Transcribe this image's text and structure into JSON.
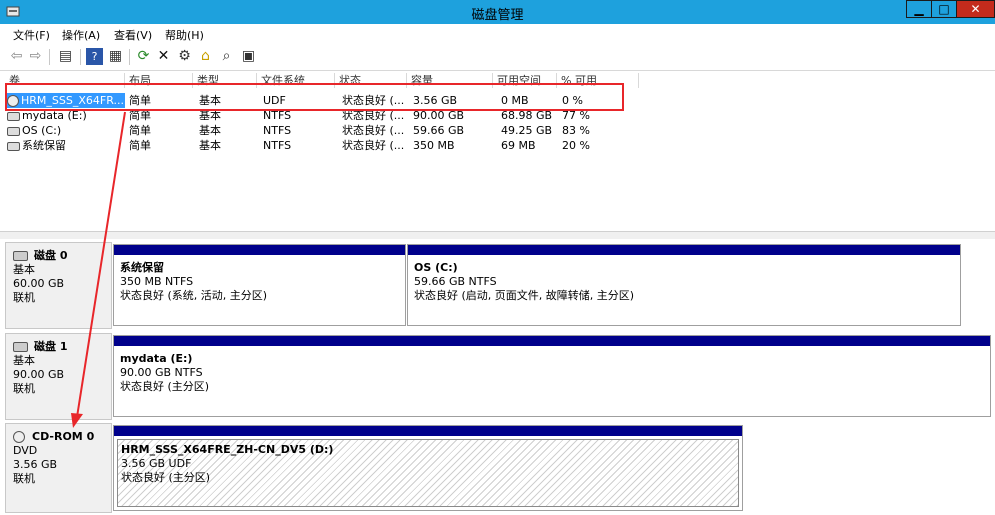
{
  "window": {
    "title": "磁盘管理",
    "min": "▁",
    "max": "□",
    "close": "✕"
  },
  "menu": [
    "文件(F)",
    "操作(A)",
    "查看(V)",
    "帮助(H)"
  ],
  "toolbar": {
    "icons": [
      "back-arrow-icon",
      "forward-arrow-icon",
      "show-hide-tree-icon",
      "help-icon",
      "properties-icon",
      "refresh-icon",
      "delete-icon",
      "settings-icon",
      "open-folder-icon",
      "search-icon",
      "disk-properties-icon"
    ]
  },
  "columns": [
    "卷",
    "布局",
    "类型",
    "文件系统",
    "状态",
    "容量",
    "可用空间",
    "% 可用"
  ],
  "volumes": [
    {
      "name": "HRM_SSS_X64FR...",
      "layout": "简单",
      "type": "基本",
      "fs": "UDF",
      "status": "状态良好 (...",
      "capacity": "3.56 GB",
      "free": "0 MB",
      "pct": "0 %",
      "icon": "cdrom-icon",
      "selected": true
    },
    {
      "name": "mydata (E:)",
      "layout": "简单",
      "type": "基本",
      "fs": "NTFS",
      "status": "状态良好 (...",
      "capacity": "90.00 GB",
      "free": "68.98 GB",
      "pct": "77 %",
      "icon": "drive-icon",
      "selected": false
    },
    {
      "name": "OS (C:)",
      "layout": "简单",
      "type": "基本",
      "fs": "NTFS",
      "status": "状态良好 (...",
      "capacity": "59.66 GB",
      "free": "49.25 GB",
      "pct": "83 %",
      "icon": "drive-icon",
      "selected": false
    },
    {
      "name": "系统保留",
      "layout": "简单",
      "type": "基本",
      "fs": "NTFS",
      "status": "状态良好 (...",
      "capacity": "350 MB",
      "free": "69 MB",
      "pct": "20 %",
      "icon": "drive-icon",
      "selected": false
    }
  ],
  "disks": [
    {
      "name": "磁盘 0",
      "type": "基本",
      "size": "60.00 GB",
      "state": "联机",
      "partitions": [
        {
          "name": "系统保留",
          "size": "350 MB NTFS",
          "status": "状态良好 (系统, 活动, 主分区)"
        },
        {
          "name": "OS  (C:)",
          "size": "59.66 GB NTFS",
          "status": "状态良好 (启动, 页面文件, 故障转储, 主分区)"
        }
      ]
    },
    {
      "name": "磁盘 1",
      "type": "基本",
      "size": "90.00 GB",
      "state": "联机",
      "partitions": [
        {
          "name": "mydata  (E:)",
          "size": "90.00 GB NTFS",
          "status": "状态良好 (主分区)"
        }
      ]
    },
    {
      "name": "CD-ROM 0",
      "type": "DVD",
      "size": "3.56 GB",
      "state": "联机",
      "partitions": [
        {
          "name": "HRM_SSS_X64FRE_ZH-CN_DV5  (D:)",
          "size": "3.56 GB UDF",
          "status": "状态良好 (主分区)"
        }
      ]
    }
  ],
  "colors": {
    "titlebar": "#1ea1dd",
    "partition_bar": "#00008b",
    "selection": "#3399ff",
    "annotation": "#e8262a"
  }
}
